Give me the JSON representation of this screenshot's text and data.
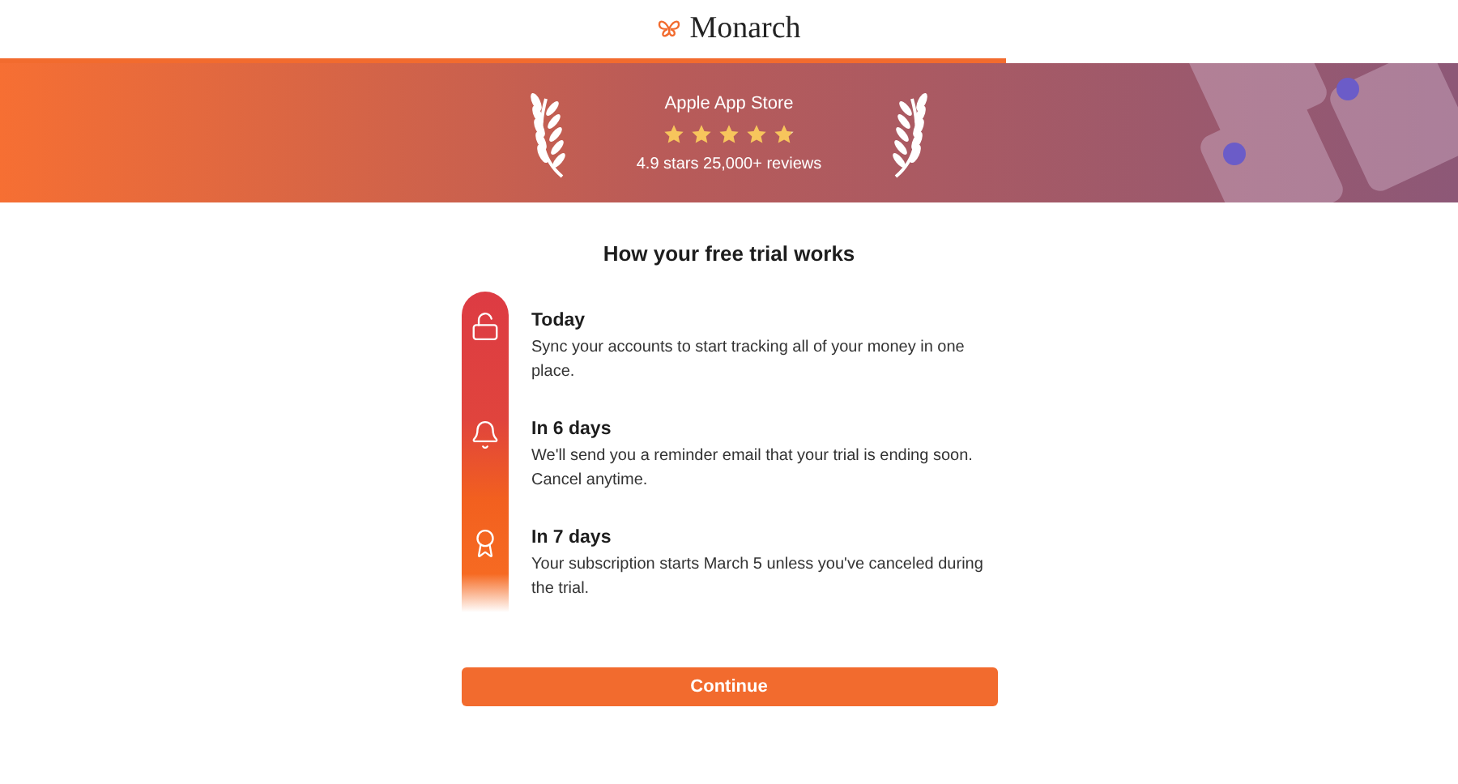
{
  "header": {
    "logo": "Monarch"
  },
  "progress": {
    "level": 0.69
  },
  "banner": {
    "title": "Apple App Store",
    "stars": 4.9,
    "caption": "4.9 stars 25,000+ reviews"
  },
  "heading": "How your free trial works",
  "steps": [
    {
      "kind": "unlock",
      "title": "Today",
      "text": "Sync your accounts to start tracking all of your money in one place."
    },
    {
      "kind": "bell",
      "title": "In 6 days",
      "text": "We'll send you a reminder email that your trial is ending soon. Cancel anytime."
    },
    {
      "kind": "award",
      "title": "In 7 days",
      "text": "Your subscription starts March 5 unless you've canceled during the trial."
    }
  ],
  "button": "Continue"
}
